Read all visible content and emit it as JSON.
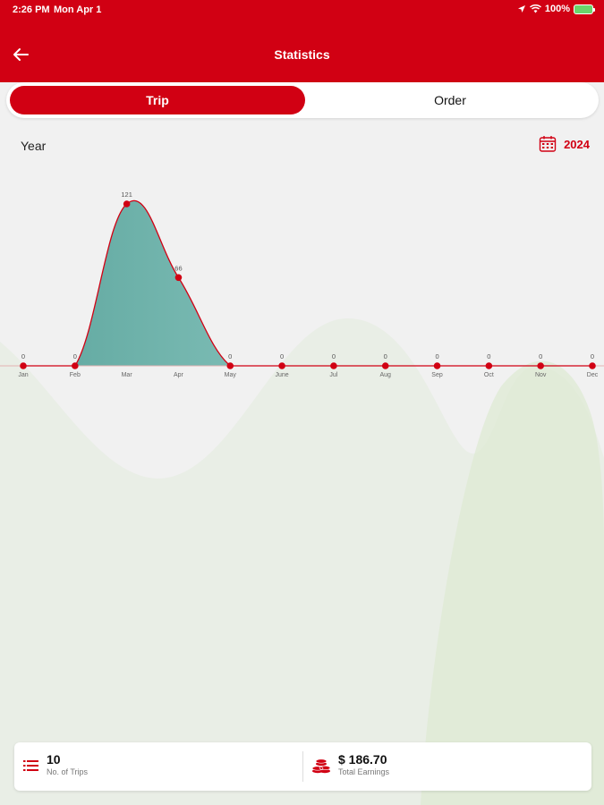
{
  "status": {
    "time": "2:26 PM",
    "date": "Mon Apr 1",
    "battery": "100%"
  },
  "header": {
    "title": "Statistics"
  },
  "tabs": [
    {
      "label": "Trip",
      "active": true
    },
    {
      "label": "Order",
      "active": false
    }
  ],
  "filter": {
    "period_label": "Year",
    "year": "2024"
  },
  "chart_data": {
    "type": "area",
    "categories": [
      "Jan",
      "Feb",
      "Mar",
      "Apr",
      "May",
      "June",
      "Jul",
      "Aug",
      "Sep",
      "Oct",
      "Nov",
      "Dec"
    ],
    "values": [
      0,
      0,
      121,
      66,
      0,
      0,
      0,
      0,
      0,
      0,
      0,
      0
    ],
    "ylim": [
      0,
      121
    ],
    "grid": false,
    "colors": {
      "line": "#d10013",
      "fill_start": "#5fa79f",
      "fill_end": "#a9dcd5",
      "point": "#d10013"
    }
  },
  "summary": {
    "trips": {
      "value": "10",
      "label": "No. of Trips"
    },
    "earnings": {
      "value": "$ 186.70",
      "label": "Total Earnings"
    }
  },
  "colors": {
    "brand": "#d10013",
    "background": "#f1f1f1"
  }
}
